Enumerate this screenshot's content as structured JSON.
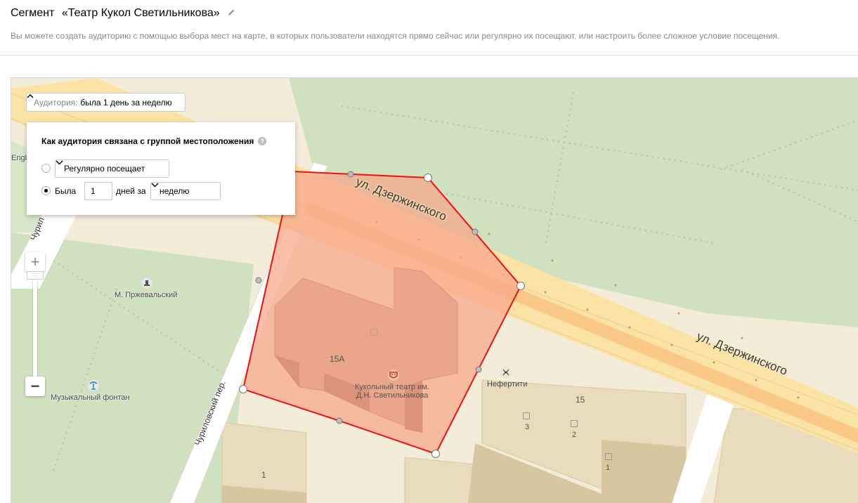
{
  "header": {
    "segment_label": "Сегмент",
    "segment_name": "«Театр Кукол Светильникова»",
    "description": "Вы можете создать аудиторию с помощью выбора мест на карте, в которых пользователи находятся прямо сейчас или регулярно их посещают, или настроить более сложное условие посещения."
  },
  "audience_button": {
    "prefix": "Аудитория:",
    "value": "была 1 день за неделю"
  },
  "popup": {
    "title": "Как аудитория связана с группой местоположения",
    "option_regular": {
      "selected": false,
      "select_value": "Регулярно посещает"
    },
    "option_was": {
      "selected": true,
      "label": "Была",
      "days_value": "1",
      "days_label": "дней за",
      "period_value": "неделю"
    }
  },
  "map": {
    "streets": [
      "ул. Дзержинского",
      "ул. Дзержинского",
      "Чуриловский пер."
    ],
    "partial_labels": [
      "Чурил",
      "Engl"
    ],
    "pois": [
      {
        "name": "М. Пржевальский",
        "icon": "monument-icon"
      },
      {
        "name": "Музыкальный фонтан",
        "icon": "fountain-icon"
      },
      {
        "name": "Кукольный театр им.",
        "name2": "Д.Н. Светильникова",
        "icon": "theater-icon"
      },
      {
        "name": "Нефертити",
        "icon": "beauty-salon-icon"
      }
    ],
    "house_numbers": [
      "15А",
      "15",
      "3",
      "2",
      "1",
      "1"
    ],
    "zoom": {
      "plus": "+",
      "minus": "−"
    }
  },
  "colors": {
    "road": "#fbe3a6",
    "road_edge": "#f2c98b",
    "main_road": "#f9c886",
    "park": "#cfe1bf",
    "ground": "#f3ecd9",
    "polygon_fill": "#f7a68a",
    "polygon_stroke": "#ee1111",
    "building": "#e5d8b6"
  }
}
